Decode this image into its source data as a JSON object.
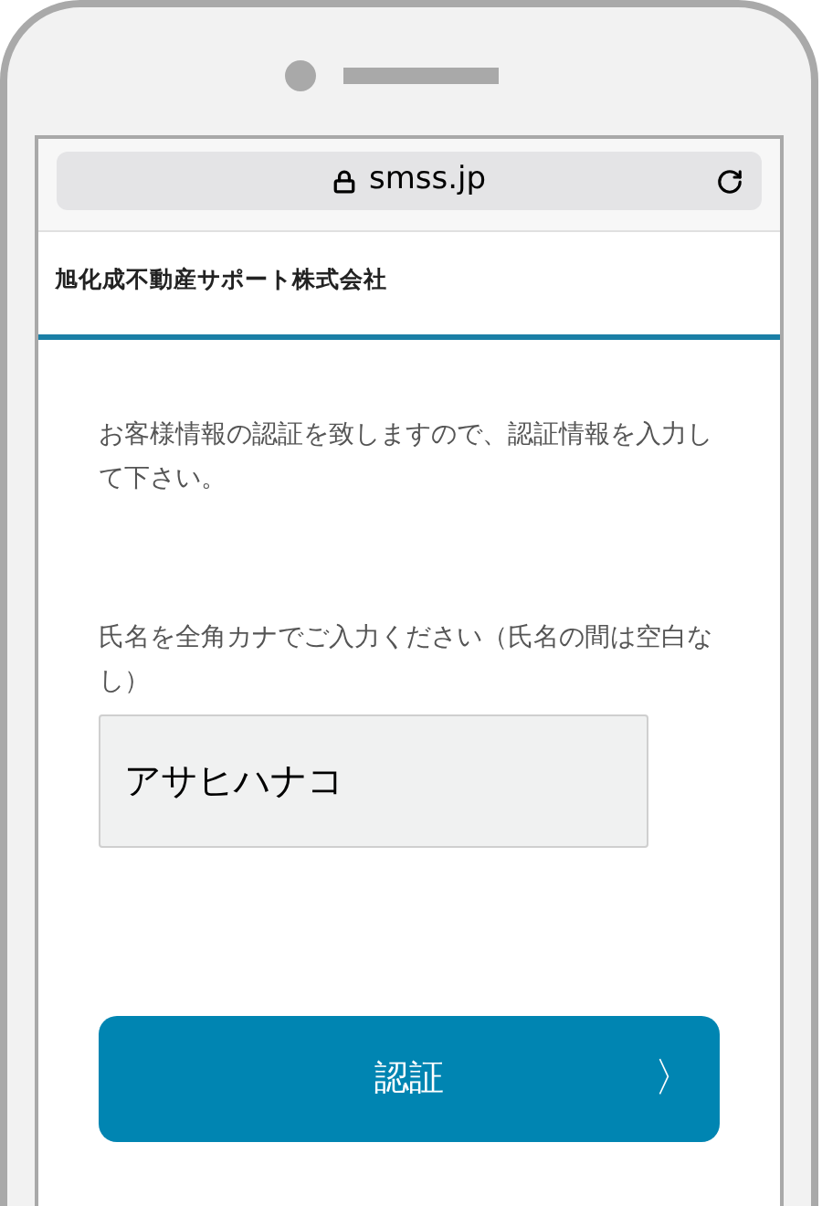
{
  "browser": {
    "url": "smss.jp"
  },
  "header": {
    "company": "旭化成不動産サポート株式会社"
  },
  "intro": "お客様情報の認証を致しますので、認証情報を入力して下さい。",
  "name_field": {
    "label": "氏名を全角カナでご入力ください（氏名の間は空白なし）",
    "value": "アサヒハナコ"
  },
  "submit_button": {
    "label": "認証",
    "arrow": "〉"
  }
}
